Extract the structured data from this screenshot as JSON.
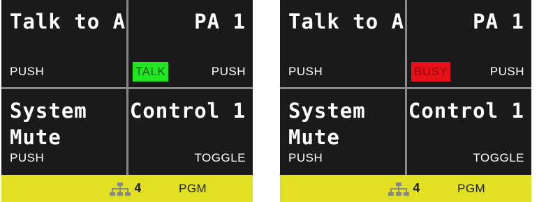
{
  "panels": [
    {
      "keys": {
        "top_left": {
          "title": "Talk to All",
          "action": "PUSH"
        },
        "top_right": {
          "title": "PA 1",
          "action": "PUSH",
          "badge": "TALK"
        },
        "bottom_left": {
          "title": "System\nMute",
          "action": "PUSH"
        },
        "bottom_right": {
          "title": "Control 1",
          "action": "TOGGLE"
        }
      },
      "status": {
        "channel": "4",
        "mode": "PGM",
        "network_icon": "network-icon"
      }
    },
    {
      "keys": {
        "top_left": {
          "title": "Talk to All",
          "action": "PUSH"
        },
        "top_right": {
          "title": "PA 1",
          "action": "PUSH",
          "badge": "BUSY"
        },
        "bottom_left": {
          "title": "System\nMute",
          "action": "PUSH"
        },
        "bottom_right": {
          "title": "Control 1",
          "action": "TOGGLE"
        }
      },
      "status": {
        "channel": "4",
        "mode": "PGM",
        "network_icon": "network-icon"
      }
    }
  ],
  "colors": {
    "screen_bg": "#1a1a1a",
    "divider": "#8a8a8a",
    "status_bar": "#e2e022",
    "talk_badge": "#22e622",
    "busy_badge": "#e8101a"
  }
}
